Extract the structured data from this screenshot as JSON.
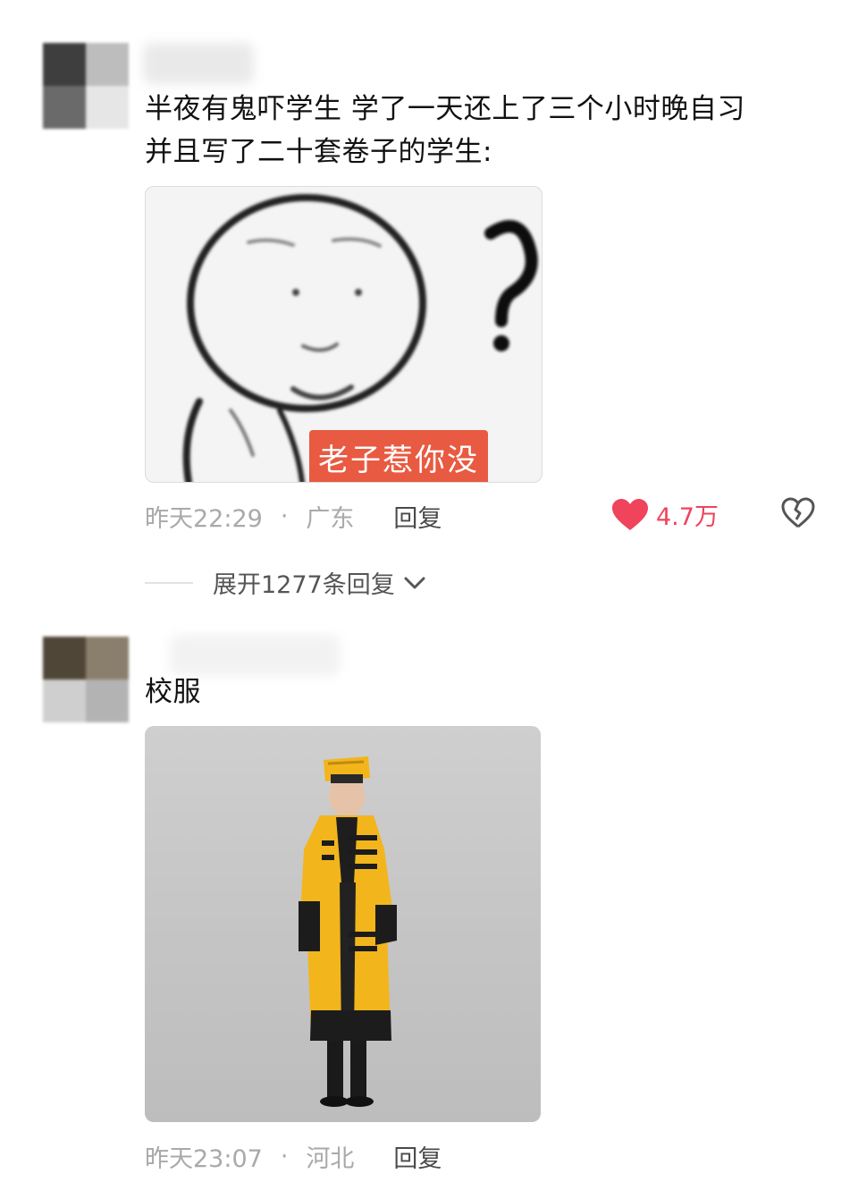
{
  "comments": [
    {
      "text_line1": "半夜有鬼吓学生 学了一天还上了三个小时晚自习",
      "text_line2": "并且写了二十套卷子的学生:",
      "image_caption": "老子惹你没",
      "time": "昨天22:29",
      "separator": "·",
      "location": "广东",
      "reply_label": "回复",
      "like_count": "4.7万",
      "expand_replies": "展开1277条回复"
    },
    {
      "text": "校服",
      "time": "昨天23:07",
      "separator": "·",
      "location": "河北",
      "reply_label": "回复"
    }
  ],
  "colors": {
    "like_red": "#f0435c",
    "meta_gray": "#a9a9a9",
    "caption_bg": "#e85a41",
    "robe_yellow": "#f2b51c"
  },
  "icons": {
    "like": "heart-filled-icon",
    "dislike": "broken-heart-icon",
    "expand": "chevron-down-icon"
  }
}
